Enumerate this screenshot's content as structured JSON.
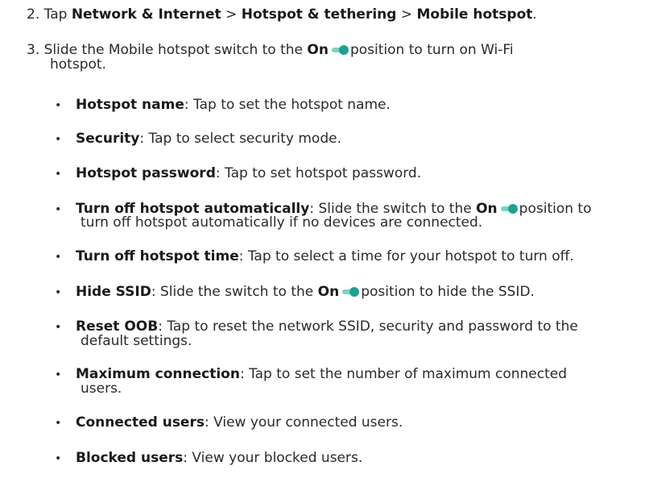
{
  "step2": {
    "number": "2.",
    "tap": "Tap",
    "network": "Network & Internet",
    "sep1": ">",
    "hotspot_tethering": "Hotspot & tethering",
    "sep2": ">",
    "mobile_hotspot": "Mobile hotspot",
    "period": "."
  },
  "step3": {
    "number": "3.",
    "line1_a": "Slide the Mobile hotspot switch to the",
    "on": "On",
    "line1_b": "position to turn on Wi-Fi",
    "line2": "hotspot."
  },
  "toggle": {
    "icon": "toggle-on-icon",
    "track_color": "#7fd1c6",
    "knob_color": "#1aa394"
  },
  "bullets": [
    {
      "marker": "•",
      "term": "Hotspot name",
      "desc": ": Tap to set the hotspot name."
    },
    {
      "marker": "•",
      "term": "Security",
      "desc": ": Tap to select security mode."
    },
    {
      "marker": "•",
      "term": "Hotspot password",
      "desc": ": Tap to set hotspot password."
    },
    {
      "marker": "•",
      "term": "Turn off hotspot automatically",
      "desc_a": ": Slide the switch to the",
      "on": "On",
      "desc_b": "position to",
      "cont": "turn off hotspot automatically if no devices are connected."
    },
    {
      "marker": "•",
      "term": "Turn off hotspot time",
      "desc": ": Tap to select a time for your hotspot to turn off."
    },
    {
      "marker": "•",
      "term": "Hide SSID",
      "desc_a": ": Slide the switch to the",
      "on": "On",
      "desc_b": "position to hide the SSID."
    },
    {
      "marker": "•",
      "term": "Reset OOB",
      "desc": ": Tap to reset the network SSID, security and password to the",
      "cont": "default settings."
    },
    {
      "marker": "•",
      "term": "Maximum connection",
      "desc": ":  Tap to set the number of maximum connected",
      "cont": "users."
    },
    {
      "marker": "•",
      "term": "Connected users",
      "desc": ": View your connected users."
    },
    {
      "marker": "•",
      "term": "Blocked users",
      "desc": ": View your blocked users."
    }
  ]
}
